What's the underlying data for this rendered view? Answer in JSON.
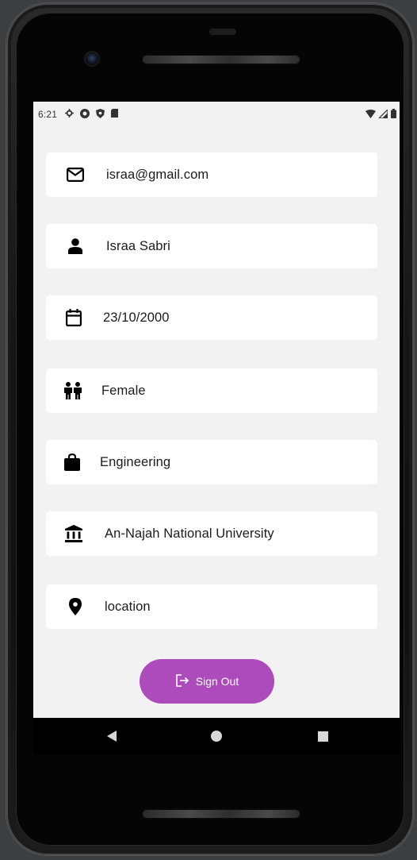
{
  "status_bar": {
    "time": "6:21",
    "left_icons": [
      "gear-icon",
      "record-icon",
      "shield-icon",
      "sd-card-icon"
    ],
    "right_icons": [
      "wifi-icon",
      "signal-icon",
      "battery-icon"
    ]
  },
  "profile": {
    "email": "israa@gmail.com",
    "name": "Israa Sabri",
    "birthdate": "23/10/2000",
    "gender": "Female",
    "major": "Engineering",
    "university": "An-Najah National University",
    "location": "location"
  },
  "actions": {
    "sign_out_label": "Sign Out"
  },
  "colors": {
    "accent": "#ad4bbd",
    "screen_background": "#f2f2f2",
    "field_background": "#ffffff"
  }
}
